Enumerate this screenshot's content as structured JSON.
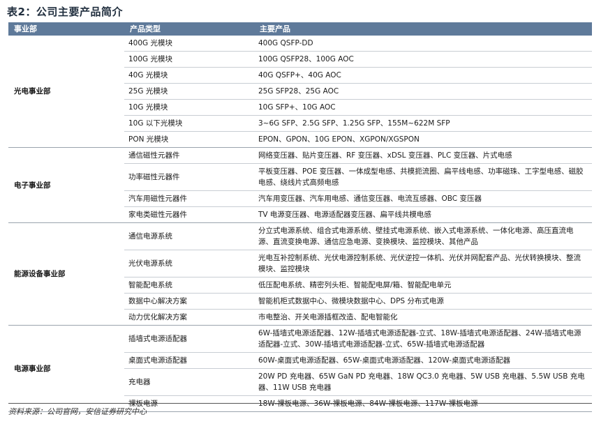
{
  "title": "表2：公司主要产品简介",
  "headers": [
    "事业部",
    "产品类型",
    "主要产品"
  ],
  "groups": [
    {
      "division": "光电事业部",
      "rows": [
        {
          "type": "400G 光模块",
          "products": "400G QSFP-DD"
        },
        {
          "type": "100G 光模块",
          "products": "100G QSFP28、100G AOC"
        },
        {
          "type": "40G 光模块",
          "products": "40G QSFP+、40G AOC"
        },
        {
          "type": "25G 光模块",
          "products": "25G SFP28、25G AOC"
        },
        {
          "type": "10G 光模块",
          "products": "10G SFP+、10G AOC"
        },
        {
          "type": "10G 以下光模块",
          "products": "3~6G SFP、2.5G SFP、1.25G SFP、155M~622M SFP"
        },
        {
          "type": "PON 光模块",
          "products": "EPON、GPON、10G EPON、XGPON/XGSPON"
        }
      ]
    },
    {
      "division": "电子事业部",
      "rows": [
        {
          "type": "通信磁性元器件",
          "products": "网络变压器、贴片变压器、RF 变压器、xDSL 变压器、PLC 变压器、片式电感"
        },
        {
          "type": "功率磁性元器件",
          "products": "平板变压器、POE 变压器、一体成型电感、共模扼流圈、扁平线电感、功率磁珠、工字型电感、磁胶电感、绕线片式高频电感"
        },
        {
          "type": "汽车用磁性元器件",
          "products": "汽车用变压器、汽车用电感、通信变压器、电流互感器、OBC 变压器"
        },
        {
          "type": "家电类磁性元器件",
          "products": "TV 电源变压器、电源适配器变压器、扁平线共模电感"
        }
      ]
    },
    {
      "division": "能源设备事业部",
      "rows": [
        {
          "type": "通信电源系统",
          "products": "分立式电源系统、组合式电源系统、壁挂式电源系统、嵌入式电源系统、一体化电源、高压直流电源、直流变换电源、通信应急电源、变换模块、监控模块、其他产品"
        },
        {
          "type": "光伏电源系统",
          "products": "光电互补控制系统、光伏电源控制系统、光伏逆控一体机、光伏并网配套产品、光伏转换模块、整流模块、监控模块"
        },
        {
          "type": "智能配电系统",
          "products": "低压配电系统、精密列头柜、智能配电屏/箱、智能配电单元"
        },
        {
          "type": "数据中心解决方案",
          "products": "智能机柜式数据中心、微模块数据中心、DPS 分布式电源"
        },
        {
          "type": "动力优化解决方案",
          "products": "市电整治、开关电源插框改造、配电智能化"
        }
      ]
    },
    {
      "division": "电源事业部",
      "rows": [
        {
          "type": "插墙式电源适配器",
          "products": "6W-插墙式电源适配器、12W-插墙式电源适配器-立式、18W-插墙式电源适配器、24W-插墙式电源适配器-立式、30W-插墙式电源适配器-立式、65W-插墙式电源适配器"
        },
        {
          "type": "桌面式电源适配器",
          "products": "60W-桌面式电源适配器、65W-桌面式电源适配器、120W-桌面式电源适配器"
        },
        {
          "type": "充电器",
          "products": "20W PD 充电器、65W GaN PD 充电器、18W QC3.0 充电器、5W USB 充电器、5.5W USB 充电器、11W USB 充电器"
        },
        {
          "type": "裸板电源",
          "products": "18W-裸板电源、36W-裸板电源、84W-裸板电源、117W-裸板电源"
        }
      ]
    }
  ],
  "source": "资料来源：公司官网，安信证券研究中心"
}
